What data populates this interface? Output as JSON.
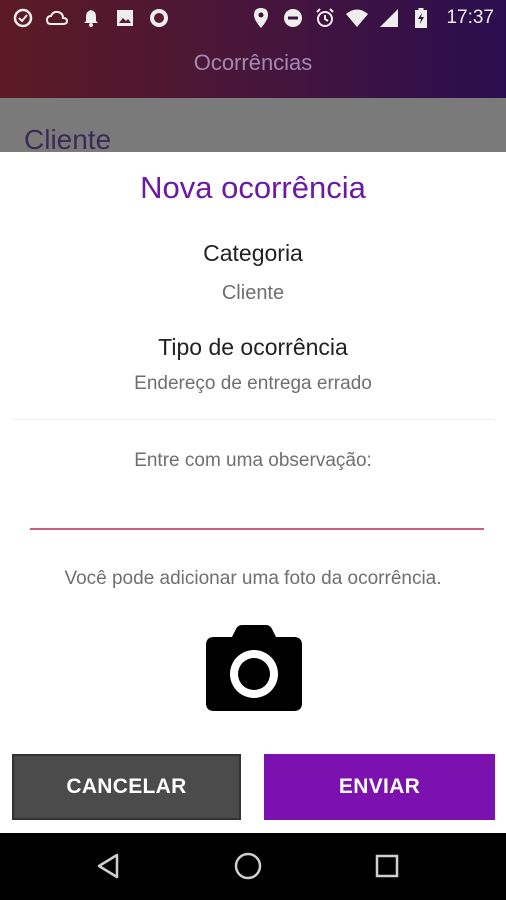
{
  "status_bar": {
    "time": "17:37",
    "icons_left": [
      "sync-icon",
      "cloud-icon",
      "notification-bell-icon",
      "image-icon",
      "record-icon"
    ],
    "icons_right": [
      "location-pin-icon",
      "do-not-disturb-icon",
      "alarm-icon",
      "wifi-icon",
      "signal-icon",
      "battery-charging-icon"
    ]
  },
  "app_bar": {
    "title": "Ocorrências"
  },
  "background": {
    "section_label": "Cliente"
  },
  "dialog": {
    "title": "Nova ocorrência",
    "category_label": "Categoria",
    "category_value": "Cliente",
    "type_label": "Tipo de ocorrência",
    "type_value": "Endereço de entrega errado",
    "observation_label": "Entre com uma observação:",
    "observation_value": "",
    "photo_hint": "Você pode adicionar uma foto da ocorrência.",
    "camera_icon": "camera-icon",
    "cancel_label": "CANCELAR",
    "send_label": "ENVIAR"
  },
  "nav_bar": {
    "icons": [
      "back-icon",
      "home-icon",
      "recents-icon"
    ]
  },
  "colors": {
    "accent": "#7b12b0",
    "title": "#6a1aa6",
    "input_underline": "#d05a86",
    "cancel_bg": "#4b4b4b"
  }
}
